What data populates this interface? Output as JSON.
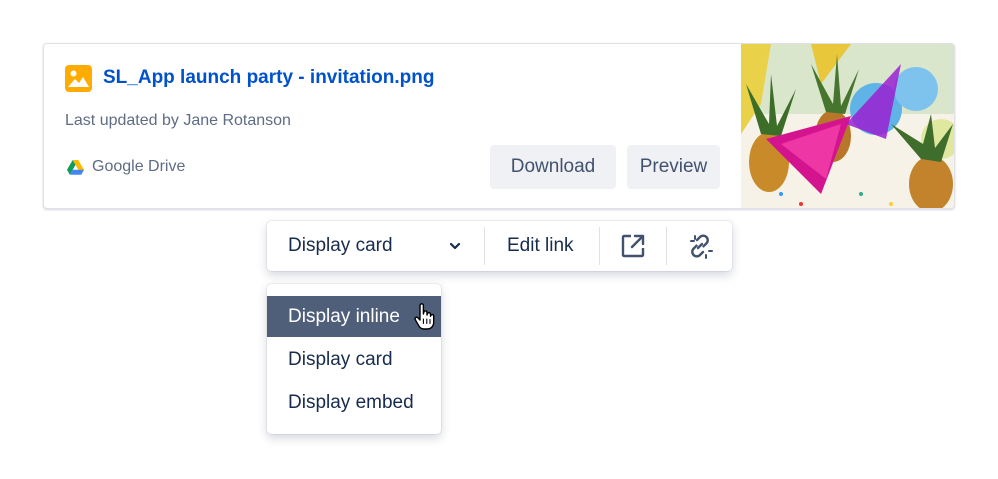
{
  "card": {
    "title": "SL_App launch party - invitation.png",
    "meta": "Last updated by Jane Rotanson",
    "provider": "Google Drive",
    "download_label": "Download",
    "preview_label": "Preview",
    "icon": "image-file-icon",
    "provider_icon": "google-drive-icon",
    "thumbnail": "party-pineapples-thumbnail"
  },
  "toolbar": {
    "display_select_label": "Display card",
    "edit_link_label": "Edit link",
    "open_icon": "open-external-icon",
    "unlink_icon": "unlink-icon"
  },
  "menu": {
    "items": [
      {
        "label": "Display inline",
        "highlighted": true
      },
      {
        "label": "Display card",
        "highlighted": false
      },
      {
        "label": "Display embed",
        "highlighted": false
      }
    ]
  },
  "colors": {
    "link": "#0052cc",
    "text": "#172b4d",
    "subtle_text": "#5e6c84",
    "button_bg": "#f0f1f4",
    "menu_highlight": "#505f79",
    "image_icon": "#ffab00"
  }
}
